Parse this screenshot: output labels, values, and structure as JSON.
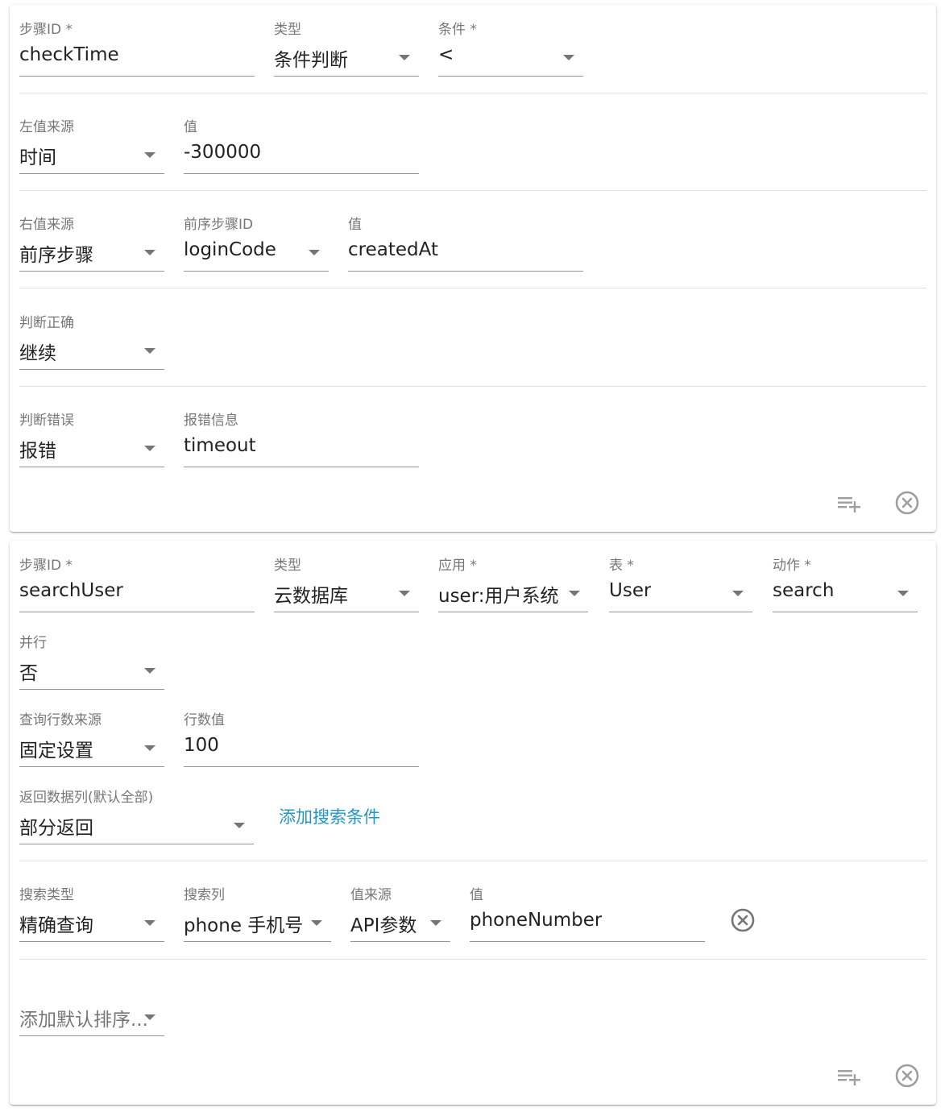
{
  "step1": {
    "step_id_label": "步骤ID *",
    "step_id_value": "checkTime",
    "type_label": "类型",
    "type_value": "条件判断",
    "condition_label": "条件 *",
    "condition_value": "<",
    "left_source_label": "左值来源",
    "left_source_value": "时间",
    "left_value_label": "值",
    "left_value_value": "-300000",
    "right_source_label": "右值来源",
    "right_source_value": "前序步骤",
    "prev_step_label": "前序步骤ID",
    "prev_step_value": "loginCode",
    "right_value_label": "值",
    "right_value_value": "createdAt",
    "on_true_label": "判断正确",
    "on_true_value": "继续",
    "on_false_label": "判断错误",
    "on_false_value": "报错",
    "error_msg_label": "报错信息",
    "error_msg_value": "timeout"
  },
  "step2": {
    "step_id_label": "步骤ID *",
    "step_id_value": "searchUser",
    "type_label": "类型",
    "type_value": "云数据库",
    "app_label": "应用 *",
    "app_value": "user:用户系统",
    "table_label": "表 *",
    "table_value": "User",
    "action_label": "动作 *",
    "action_value": "search",
    "parallel_label": "并行",
    "parallel_value": "否",
    "row_source_label": "查询行数来源",
    "row_source_value": "固定设置",
    "row_count_label": "行数值",
    "row_count_value": "100",
    "return_cols_label": "返回数据列(默认全部)",
    "return_cols_value": "部分返回",
    "add_condition_link": "添加搜索条件",
    "search_type_label": "搜索类型",
    "search_type_value": "精确查询",
    "search_col_label": "搜索列",
    "search_col_value": "phone 手机号",
    "value_source_label": "值来源",
    "value_source_value": "API参数",
    "search_value_label": "值",
    "search_value_value": "phoneNumber",
    "add_sort_placeholder": "添加默认排序..."
  },
  "icons": {
    "add_row": "playlist-add-icon",
    "remove": "close-circle-icon"
  },
  "colors": {
    "link": "#2196c9",
    "icon": "#9e9e9e"
  }
}
